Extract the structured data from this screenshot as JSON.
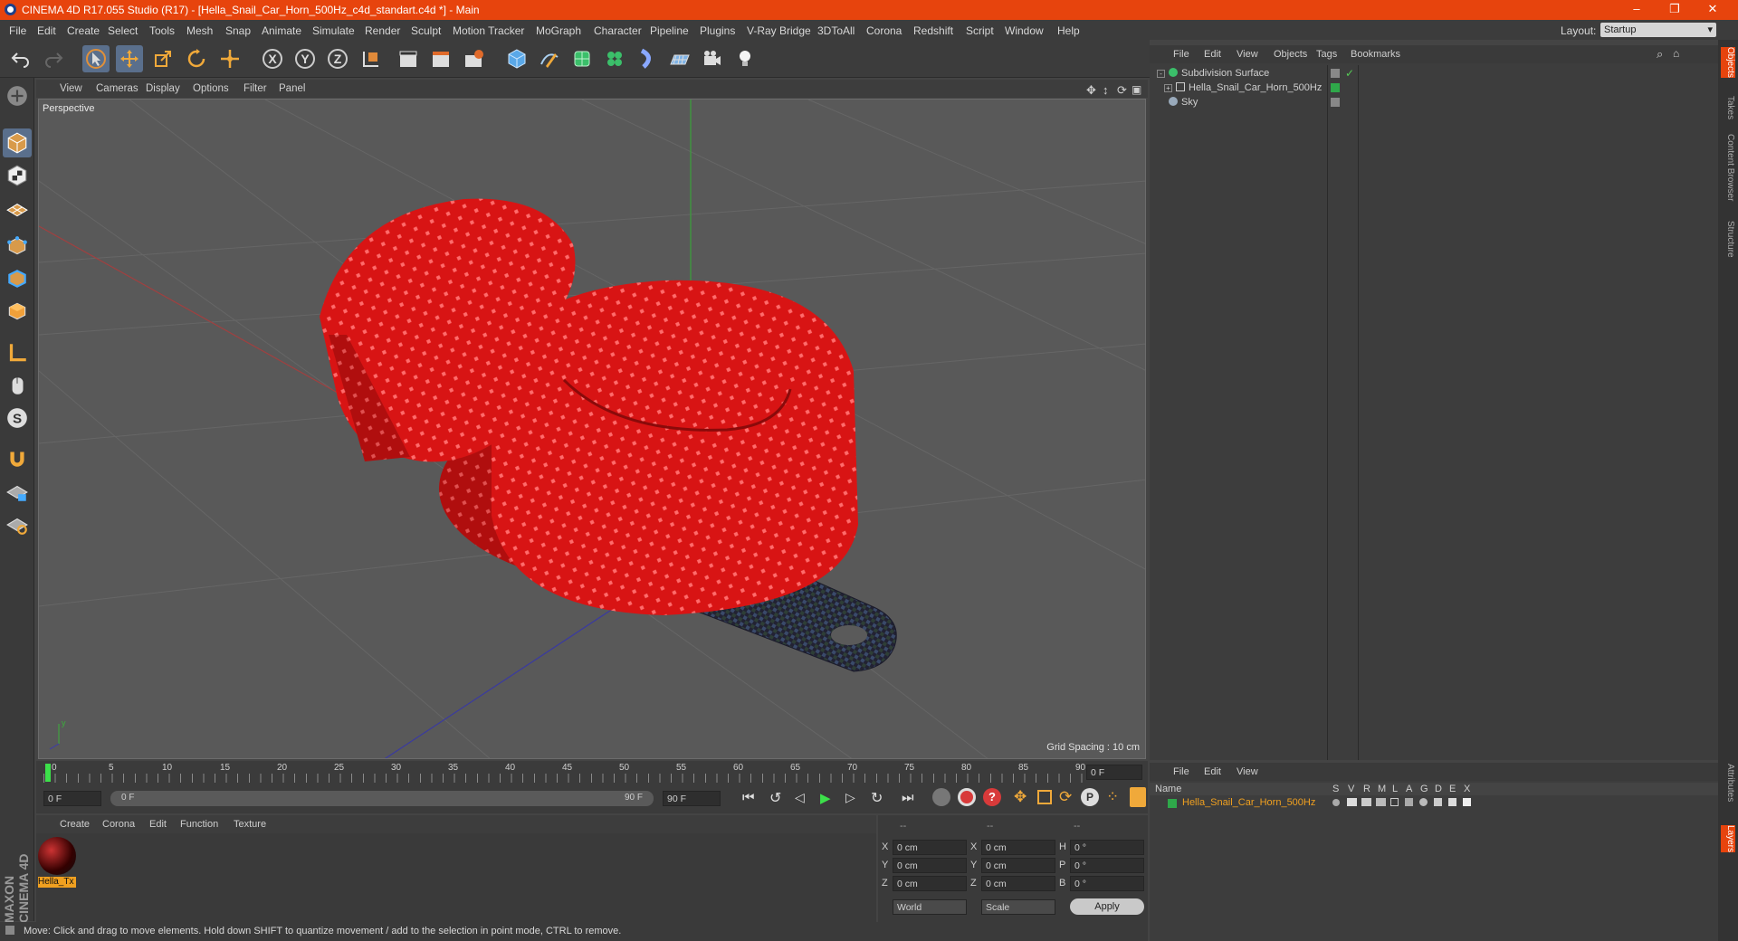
{
  "window": {
    "title": "CINEMA 4D R17.055 Studio (R17) - [Hella_Snail_Car_Horn_500Hz_c4d_standart.c4d *] - Main",
    "minimize": "–",
    "restore": "❐",
    "close": "✕"
  },
  "menubar": {
    "items": [
      "File",
      "Edit",
      "Create",
      "Select",
      "Tools",
      "Mesh",
      "Snap",
      "Animate",
      "Simulate",
      "Render",
      "Sculpt",
      "Motion Tracker",
      "MoGraph",
      "Character",
      "Pipeline",
      "Plugins",
      "V-Ray Bridge",
      "3DToAll",
      "Corona",
      "Redshift",
      "Script",
      "Window",
      "Help"
    ],
    "layout_label": "Layout:",
    "layout_value": "Startup"
  },
  "viewport": {
    "menu": [
      "View",
      "Cameras",
      "Display",
      "Options",
      "Filter",
      "Panel"
    ],
    "camera": "Perspective",
    "grid_spacing": "Grid Spacing : 10 cm"
  },
  "timeline": {
    "ticks": [
      "0",
      "5",
      "10",
      "15",
      "20",
      "25",
      "30",
      "35",
      "40",
      "45",
      "50",
      "55",
      "60",
      "65",
      "70",
      "75",
      "80",
      "85",
      "90"
    ],
    "current_frame": "0 F",
    "start_field": "0 F",
    "slider_start": "0 F",
    "slider_end": "90 F",
    "end_field": "90 F"
  },
  "material_panel": {
    "menu": [
      "Create",
      "Corona",
      "Edit",
      "Function",
      "Texture"
    ],
    "material_label": "Hella_Tx"
  },
  "coord_panel": {
    "header": [
      "--",
      "--",
      "--"
    ],
    "rows": [
      {
        "a": "X",
        "v1": "0 cm",
        "b": "X",
        "v2": "0 cm",
        "c": "H",
        "v3": "0 °"
      },
      {
        "a": "Y",
        "v1": "0 cm",
        "b": "Y",
        "v2": "0 cm",
        "c": "P",
        "v3": "0 °"
      },
      {
        "a": "Z",
        "v1": "0 cm",
        "b": "Z",
        "v2": "0 cm",
        "c": "B",
        "v3": "0 °"
      }
    ],
    "mode1": "World",
    "mode2": "Scale",
    "apply": "Apply"
  },
  "object_manager": {
    "menu": [
      "File",
      "Edit",
      "View",
      "Objects",
      "Tags",
      "Bookmarks"
    ],
    "objects": [
      "Subdivision Surface",
      "Hella_Snail_Car_Horn_500Hz",
      "Sky"
    ]
  },
  "layer_manager": {
    "menu": [
      "File",
      "Edit",
      "View"
    ],
    "columns": [
      "Name",
      "S",
      "V",
      "R",
      "M",
      "L",
      "A",
      "G",
      "D",
      "E",
      "X"
    ],
    "layer_name": "Hella_Snail_Car_Horn_500Hz"
  },
  "right_tabs": [
    "Objects",
    "Takes",
    "Content Browser",
    "Structure",
    "Attributes",
    "Layers"
  ],
  "status": "Move: Click and drag to move elements. Hold down SHIFT to quantize movement / add to the selection in point mode, CTRL to remove.",
  "brand": "MAXON CINEMA 4D"
}
